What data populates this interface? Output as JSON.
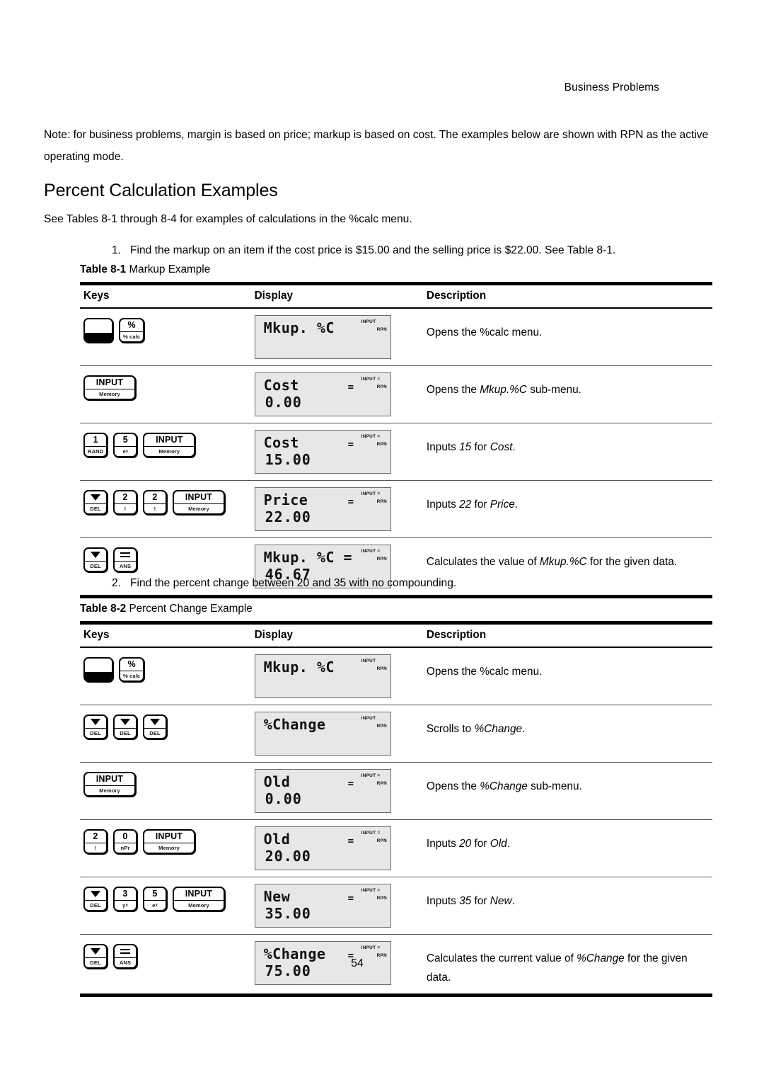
{
  "header": {
    "running_head": "Business Problems"
  },
  "note": "Note: for business problems, margin is based on price; markup is based on cost. The examples below are shown with RPN as the active operating mode.",
  "heading": "Percent Calculation Examples",
  "intro": "See Tables 8-1 through 8-4 for examples of calculations in the %calc menu.",
  "items": [
    {
      "number": "1.",
      "text": "Find the markup on an item if the cost price is $15.00 and the selling price is $22.00. See Table 8-1."
    },
    {
      "number": "2.",
      "text": "Find the percent change between 20 and 35 with no compounding."
    }
  ],
  "tables": [
    {
      "caption_label": "Table 8-1",
      "caption_title": "Markup Example",
      "columns": [
        "Keys",
        "Display",
        "Description"
      ],
      "rows": [
        {
          "keys": [
            {
              "top": "",
              "bottom": "",
              "type": "shift",
              "name": "shift-key"
            },
            {
              "top": "%",
              "bottom": "% calc",
              "type": "normal",
              "name": "percent-calc-key"
            }
          ],
          "display": {
            "line1": "Mkup. %C",
            "line2": "",
            "eq_mid": "",
            "ann_input": "INPUT",
            "ann_rpn": "RPN"
          },
          "description": "Opens the %calc menu.",
          "desc_parts": [
            {
              "t": "Opens the %calc menu.",
              "i": false
            }
          ]
        },
        {
          "keys": [
            {
              "top": "INPUT",
              "bottom": "Memory",
              "type": "wide",
              "name": "input-memory-key"
            }
          ],
          "display": {
            "line1": "Cost",
            "line2": "0.00",
            "eq_mid": "=",
            "ann_input": "INPUT  =",
            "ann_rpn": "RPN"
          },
          "description": "Opens the Mkup.%C sub-menu.",
          "desc_parts": [
            {
              "t": "Opens the ",
              "i": false
            },
            {
              "t": "Mkup.%C",
              "i": true
            },
            {
              "t": " sub-menu.",
              "i": false
            }
          ]
        },
        {
          "keys": [
            {
              "top": "1",
              "bottom": "RAND",
              "type": "normal",
              "name": "digit-1-key"
            },
            {
              "top": "5",
              "bottom": "e^x",
              "type": "normal",
              "name": "digit-5-key"
            },
            {
              "top": "INPUT",
              "bottom": "Memory",
              "type": "wide",
              "name": "input-memory-key"
            }
          ],
          "display": {
            "line1": "Cost",
            "line2": "15.00",
            "eq_mid": "=",
            "ann_input": "INPUT  =",
            "ann_rpn": "RPN"
          },
          "description": "Inputs 15 for Cost.",
          "desc_parts": [
            {
              "t": "Inputs ",
              "i": false
            },
            {
              "t": "15",
              "i": true
            },
            {
              "t": " for ",
              "i": false
            },
            {
              "t": "Cost",
              "i": true
            },
            {
              "t": ".",
              "i": false
            }
          ]
        },
        {
          "keys": [
            {
              "top": "▼",
              "bottom": "DEL",
              "type": "arrow",
              "name": "down-arrow-del-key"
            },
            {
              "top": "2",
              "bottom": "!",
              "type": "normal",
              "name": "digit-2-key"
            },
            {
              "top": "2",
              "bottom": "!",
              "type": "normal",
              "name": "digit-2-key"
            },
            {
              "top": "INPUT",
              "bottom": "Memory",
              "type": "wide",
              "name": "input-memory-key"
            }
          ],
          "display": {
            "line1": "Price",
            "line2": "22.00",
            "eq_mid": "=",
            "ann_input": "INPUT  =",
            "ann_rpn": "RPN"
          },
          "description": "Inputs 22 for Price.",
          "desc_parts": [
            {
              "t": "Inputs ",
              "i": false
            },
            {
              "t": "22",
              "i": true
            },
            {
              "t": " for ",
              "i": false
            },
            {
              "t": "Price",
              "i": true
            },
            {
              "t": ".",
              "i": false
            }
          ]
        },
        {
          "keys": [
            {
              "top": "▼",
              "bottom": "DEL",
              "type": "arrow",
              "name": "down-arrow-del-key"
            },
            {
              "top": "=",
              "bottom": "ANS",
              "type": "equals",
              "name": "equals-ans-key"
            }
          ],
          "display": {
            "line1": "Mkup. %C =",
            "line2": "46.67",
            "eq_mid": "",
            "ann_input": "INPUT  =",
            "ann_rpn": "RPN"
          },
          "description": "Calculates the value of Mkup.%C for the given data.",
          "desc_parts": [
            {
              "t": "Calculates the value of ",
              "i": false
            },
            {
              "t": "Mkup.%C",
              "i": true
            },
            {
              "t": " for the given data.",
              "i": false
            }
          ]
        }
      ]
    },
    {
      "caption_label": "Table 8-2",
      "caption_title": "Percent Change Example",
      "columns": [
        "Keys",
        "Display",
        "Description"
      ],
      "rows": [
        {
          "keys": [
            {
              "top": "",
              "bottom": "",
              "type": "shift",
              "name": "shift-key"
            },
            {
              "top": "%",
              "bottom": "% calc",
              "type": "normal",
              "name": "percent-calc-key"
            }
          ],
          "display": {
            "line1": "Mkup. %C",
            "line2": "",
            "eq_mid": "",
            "ann_input": "INPUT",
            "ann_rpn": "RPN"
          },
          "description": "Opens the %calc menu.",
          "desc_parts": [
            {
              "t": "Opens the %calc menu.",
              "i": false
            }
          ]
        },
        {
          "keys": [
            {
              "top": "▼",
              "bottom": "DEL",
              "type": "arrow",
              "name": "down-arrow-del-key"
            },
            {
              "top": "▼",
              "bottom": "DEL",
              "type": "arrow",
              "name": "down-arrow-del-key"
            },
            {
              "top": "▼",
              "bottom": "DEL",
              "type": "arrow",
              "name": "down-arrow-del-key"
            }
          ],
          "display": {
            "line1": "%Change",
            "line2": "",
            "eq_mid": "",
            "ann_input": "INPUT",
            "ann_rpn": "RPN"
          },
          "description": "Scrolls to %Change.",
          "desc_parts": [
            {
              "t": "Scrolls to ",
              "i": false
            },
            {
              "t": "%Change",
              "i": true
            },
            {
              "t": ".",
              "i": false
            }
          ]
        },
        {
          "keys": [
            {
              "top": "INPUT",
              "bottom": "Memory",
              "type": "wide",
              "name": "input-memory-key"
            }
          ],
          "display": {
            "line1": "Old",
            "line2": "0.00",
            "eq_mid": "=",
            "ann_input": "INPUT  =",
            "ann_rpn": "RPN"
          },
          "description": "Opens the %Change sub-menu.",
          "desc_parts": [
            {
              "t": "Opens the ",
              "i": false
            },
            {
              "t": "%Change",
              "i": true
            },
            {
              "t": " sub-menu.",
              "i": false
            }
          ]
        },
        {
          "keys": [
            {
              "top": "2",
              "bottom": "!",
              "type": "normal",
              "name": "digit-2-key"
            },
            {
              "top": "0",
              "bottom": "nPr",
              "type": "normal",
              "name": "digit-0-key"
            },
            {
              "top": "INPUT",
              "bottom": "Memory",
              "type": "wide",
              "name": "input-memory-key"
            }
          ],
          "display": {
            "line1": "Old",
            "line2": "20.00",
            "eq_mid": "=",
            "ann_input": "INPUT  =",
            "ann_rpn": "RPN"
          },
          "description": "Inputs 20 for Old.",
          "desc_parts": [
            {
              "t": "Inputs ",
              "i": false
            },
            {
              "t": "20",
              "i": true
            },
            {
              "t": " for ",
              "i": false
            },
            {
              "t": "Old",
              "i": true
            },
            {
              "t": ".",
              "i": false
            }
          ]
        },
        {
          "keys": [
            {
              "top": "▼",
              "bottom": "DEL",
              "type": "arrow",
              "name": "down-arrow-del-key"
            },
            {
              "top": "3",
              "bottom": "y^x",
              "type": "normal",
              "name": "digit-3-key"
            },
            {
              "top": "5",
              "bottom": "e^x",
              "type": "normal",
              "name": "digit-5-key"
            },
            {
              "top": "INPUT",
              "bottom": "Memory",
              "type": "wide",
              "name": "input-memory-key"
            }
          ],
          "display": {
            "line1": "New",
            "line2": "35.00",
            "eq_mid": "=",
            "ann_input": "INPUT  =",
            "ann_rpn": "RPN"
          },
          "description": "Inputs 35 for New.",
          "desc_parts": [
            {
              "t": "Inputs ",
              "i": false
            },
            {
              "t": "35",
              "i": true
            },
            {
              "t": " for ",
              "i": false
            },
            {
              "t": "New",
              "i": true
            },
            {
              "t": ".",
              "i": false
            }
          ]
        },
        {
          "keys": [
            {
              "top": "▼",
              "bottom": "DEL",
              "type": "arrow",
              "name": "down-arrow-del-key"
            },
            {
              "top": "=",
              "bottom": "ANS",
              "type": "equals",
              "name": "equals-ans-key"
            }
          ],
          "display": {
            "line1": "%Change",
            "line2": "75.00",
            "eq_mid": "=",
            "ann_input": "INPUT  =",
            "ann_rpn": "RPN"
          },
          "description": "Calculates the current value of %Change for the given data.",
          "desc_parts": [
            {
              "t": "Calculates the current value of ",
              "i": false
            },
            {
              "t": "%Change",
              "i": true
            },
            {
              "t": " for the given data.",
              "i": false
            }
          ]
        }
      ]
    }
  ],
  "folio": "54"
}
